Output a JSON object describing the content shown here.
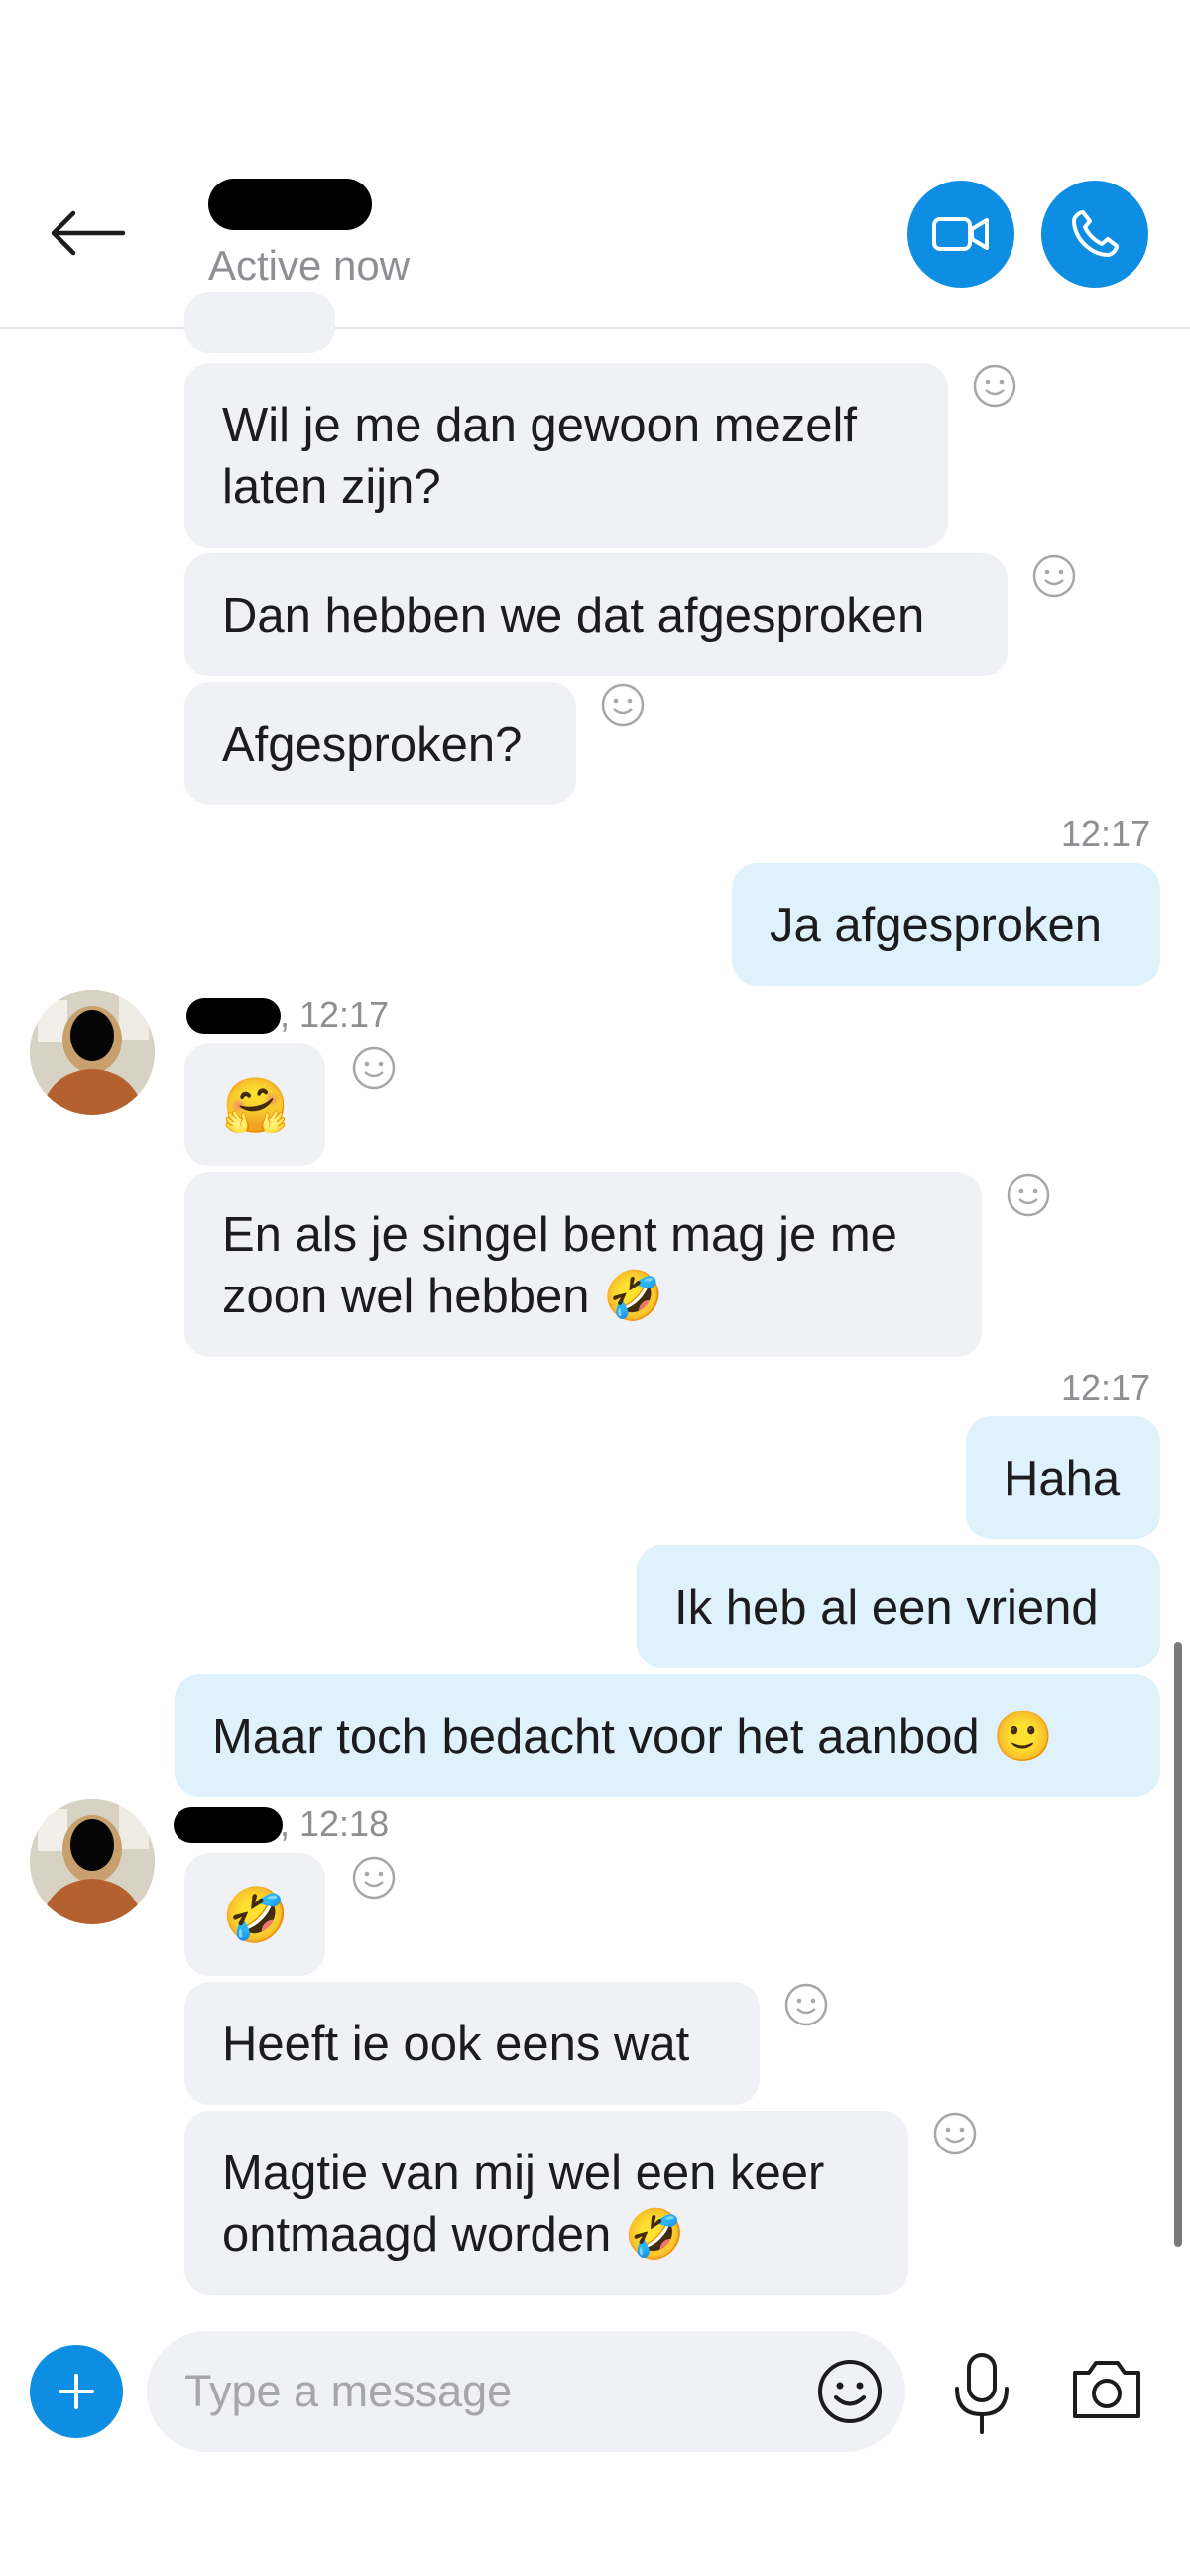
{
  "header": {
    "status": "Active now",
    "icons": {
      "back": "back-arrow-icon",
      "video": "video-camera-icon",
      "phone": "phone-icon"
    }
  },
  "messages": [
    {
      "text": "Wil je me dan gewoon mezelf\nlaten zijn?"
    },
    {
      "text": "Dan hebben we dat afgesproken"
    },
    {
      "text": "Afgesproken?"
    },
    {
      "time": "12:17",
      "text": "Ja afgesproken"
    },
    {
      "sender_time": ", 12:17",
      "text": "🤗"
    },
    {
      "text": "En als je singel bent mag je me\nzoon wel hebben 🤣"
    },
    {
      "time": "12:17",
      "text": "Haha"
    },
    {
      "text": "Ik heb al een vriend"
    },
    {
      "text": "Maar toch bedacht voor het aanbod 🙂"
    },
    {
      "sender_time": ", 12:18",
      "text": "🤣"
    },
    {
      "text": "Heeft ie ook eens wat"
    },
    {
      "text": "Magtie van mij wel een keer\nontmaagd worden 🤣"
    }
  ],
  "composer": {
    "placeholder": "Type a message",
    "icons": {
      "add": "plus-icon",
      "emoji": "smiley-icon",
      "mic": "microphone-icon",
      "camera": "camera-icon"
    }
  },
  "colors": {
    "accent": "#0e8ee3",
    "incoming": "#eff1f5",
    "outgoing": "#dff1fb"
  }
}
